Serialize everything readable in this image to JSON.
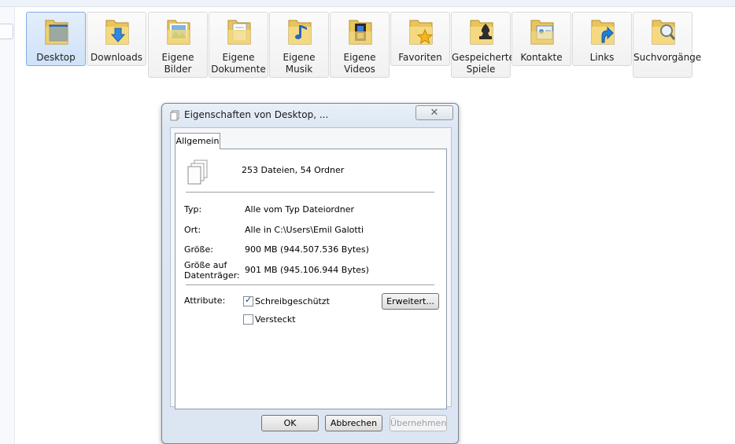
{
  "folders": [
    {
      "label": "Desktop",
      "icon": "desktop-folder-icon",
      "selected": true
    },
    {
      "label": "Downloads",
      "icon": "downloads-folder-icon"
    },
    {
      "label": "Eigene Bilder",
      "icon": "pictures-folder-icon"
    },
    {
      "label": "Eigene Dokumente",
      "icon": "documents-folder-icon"
    },
    {
      "label": "Eigene Musik",
      "icon": "music-folder-icon"
    },
    {
      "label": "Eigene Videos",
      "icon": "videos-folder-icon"
    },
    {
      "label": "Favoriten",
      "icon": "favorites-folder-icon"
    },
    {
      "label": "Gespeicherte Spiele",
      "icon": "saved-games-folder-icon"
    },
    {
      "label": "Kontakte",
      "icon": "contacts-folder-icon"
    },
    {
      "label": "Links",
      "icon": "links-folder-icon"
    },
    {
      "label": "Suchvorgänge",
      "icon": "searches-folder-icon"
    }
  ],
  "dialog": {
    "title": "Eigenschaften von Desktop, ...",
    "close_symbol": "✕",
    "tab": "Allgemein",
    "summary": "253 Dateien, 54 Ordner",
    "rows": {
      "typ_label": "Typ:",
      "typ_value": "Alle vom Typ Dateiordner",
      "ort_label": "Ort:",
      "ort_value": "Alle in C:\\Users\\Emil Galotti",
      "groesse_label": "Größe:",
      "groesse_value": "900 MB (944.507.536 Bytes)",
      "disk_label": "Größe auf Datenträger:",
      "disk_value": "901 MB (945.106.944 Bytes)"
    },
    "attributes_label": "Attribute:",
    "readonly_label": "Schreibgeschützt",
    "readonly_checked": true,
    "hidden_label": "Versteckt",
    "hidden_checked": false,
    "advanced_button": "Erweitert...",
    "ok_button": "OK",
    "cancel_button": "Abbrechen",
    "apply_button": "Übernehmen"
  }
}
